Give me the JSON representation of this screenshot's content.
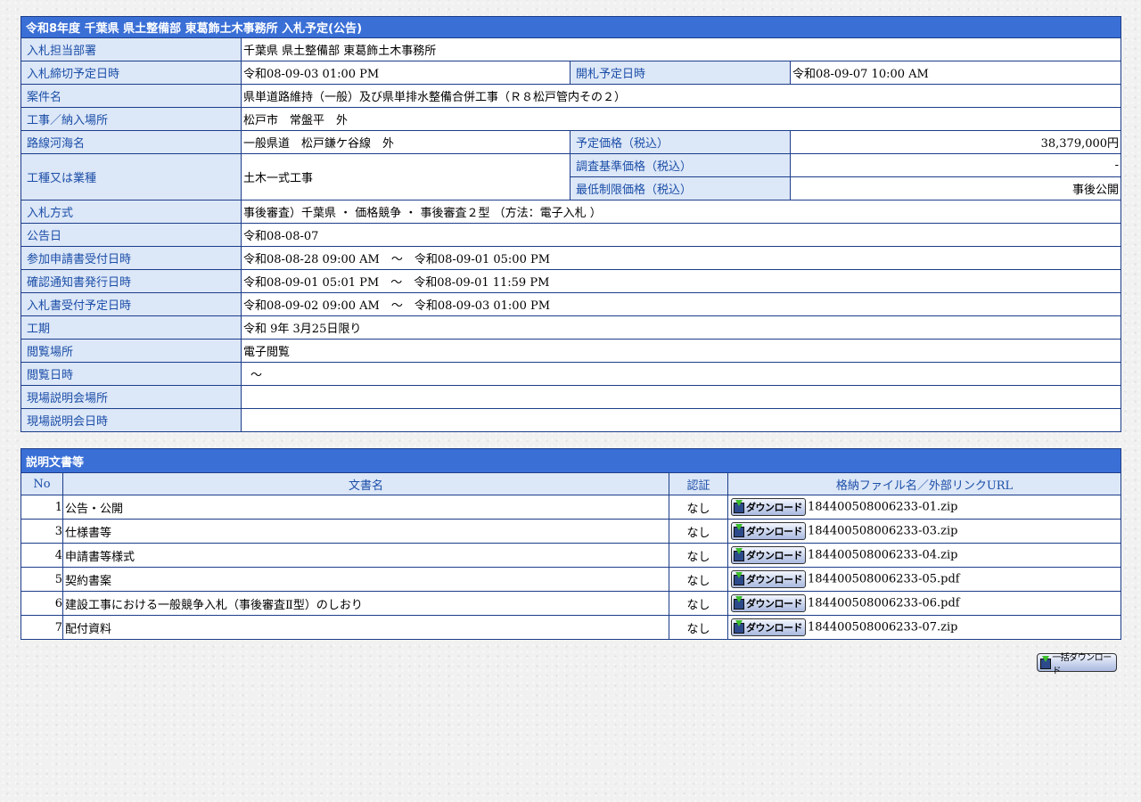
{
  "info": {
    "title": "令和8年度 千葉県 県土整備部 東葛飾土木事務所 入札予定(公告)",
    "dept": {
      "label": "入札担当部署",
      "value": "千葉県 県土整備部 東葛飾土木事務所"
    },
    "deadline": {
      "label": "入札締切予定日時",
      "value": "令和08-09-03 01:00 PM"
    },
    "opening": {
      "label": "開札予定日時",
      "value": "令和08-09-07 10:00 AM"
    },
    "project": {
      "label": "案件名",
      "value": "県単道路維持（一般）及び県単排水整備合併工事（Ｒ８松戸管内その２）"
    },
    "location": {
      "label": "工事／納入場所",
      "value": "松戸市　常盤平　外"
    },
    "route": {
      "label": "路線河海名",
      "value": "一般県道　松戸鎌ケ谷線　外"
    },
    "price": {
      "label": "予定価格（税込）",
      "value": "38,379,000円"
    },
    "category": {
      "label": "工種又は業種",
      "value": "土木一式工事"
    },
    "survey_price": {
      "label": "調査基準価格（税込）",
      "value": "-"
    },
    "min_price": {
      "label": "最低制限価格（税込）",
      "value": "事後公開"
    },
    "method": {
      "label": "入札方式",
      "value": "事後審査）千葉県 ・ 価格競争 ・ 事後審査２型 （方法：電子入札 ）"
    },
    "notice_date": {
      "label": "公告日",
      "value": "令和08-08-07"
    },
    "application": {
      "label": "参加申請書受付日時",
      "value": "令和08-08-28 09:00 AM　～　令和08-09-01 05:00 PM"
    },
    "confirmation": {
      "label": "確認通知書発行日時",
      "value": "令和08-09-01 05:01 PM　～　令和08-09-01 11:59 PM"
    },
    "bid_receipt": {
      "label": "入札書受付予定日時",
      "value": "令和08-09-02 09:00 AM　～　令和08-09-03 01:00 PM"
    },
    "period": {
      "label": "工期",
      "value": "令和 9年 3月25日限り"
    },
    "viewing_place": {
      "label": "閲覧場所",
      "value": "電子閲覧"
    },
    "viewing_date": {
      "label": "閲覧日時",
      "value": "～"
    },
    "briefing_place": {
      "label": "現場説明会場所",
      "value": ""
    },
    "briefing_date": {
      "label": "現場説明会日時",
      "value": ""
    }
  },
  "docs": {
    "title": "説明文書等",
    "headers": {
      "no": "No",
      "name": "文書名",
      "cert": "認証",
      "file": "格納ファイル名／外部リンクURL"
    },
    "download_label": "ダウンロード",
    "rows": [
      {
        "no": "1",
        "name": "公告・公開",
        "cert": "なし",
        "file": "184400508006233-01.zip"
      },
      {
        "no": "3",
        "name": "仕様書等",
        "cert": "なし",
        "file": "184400508006233-03.zip"
      },
      {
        "no": "4",
        "name": "申請書等様式",
        "cert": "なし",
        "file": "184400508006233-04.zip"
      },
      {
        "no": "5",
        "name": "契約書案",
        "cert": "なし",
        "file": "184400508006233-05.pdf"
      },
      {
        "no": "6",
        "name": "建設工事における一般競争入札（事後審査Ⅱ型）のしおり",
        "cert": "なし",
        "file": "184400508006233-06.pdf"
      },
      {
        "no": "7",
        "name": "配付資料",
        "cert": "なし",
        "file": "184400508006233-07.zip"
      }
    ]
  },
  "bulk_download_label": "一括ダウンロード",
  "colors": {
    "header_bg": "#3a6fd6",
    "label_bg": "#dce7f7",
    "label_text": "#1b4ea8",
    "border": "#1c3d8a"
  }
}
